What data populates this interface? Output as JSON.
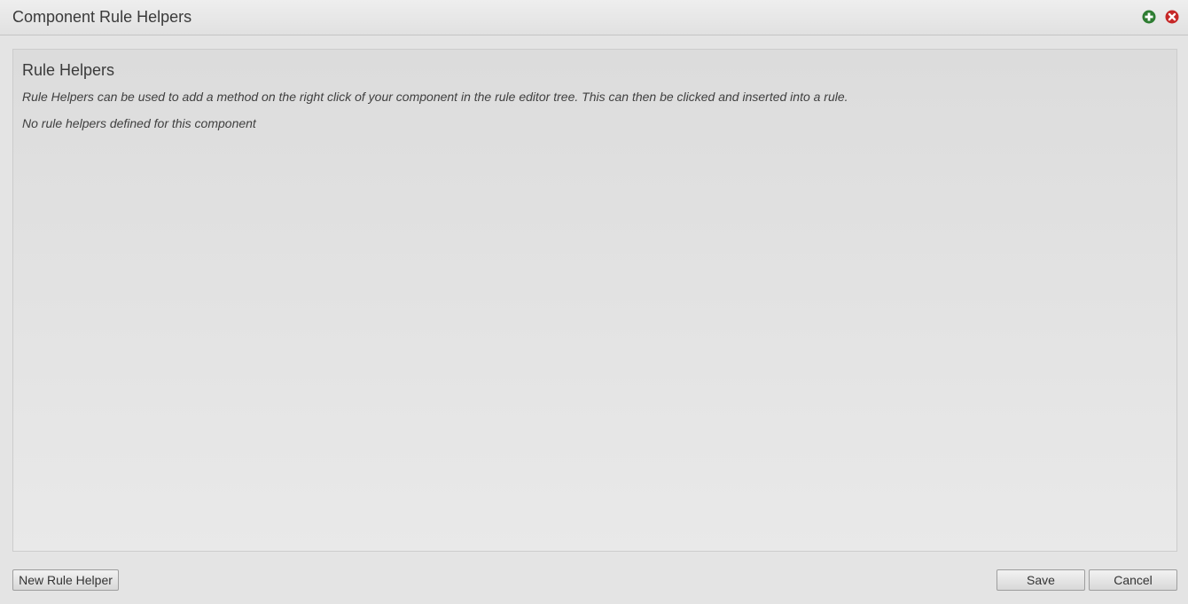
{
  "window": {
    "title": "Component Rule Helpers",
    "icons": {
      "add": "plus-circle-icon",
      "close": "close-circle-icon"
    }
  },
  "panel": {
    "heading": "Rule Helpers",
    "description": "Rule Helpers can be used to add a method on the right click of your component in the rule editor tree. This can then be clicked and inserted into a rule.",
    "empty_message": "No rule helpers defined for this component"
  },
  "footer": {
    "new_button_label": "New Rule Helper",
    "save_button_label": "Save",
    "cancel_button_label": "Cancel"
  },
  "colors": {
    "add_icon": "#2e7d32",
    "close_icon": "#c62828"
  }
}
